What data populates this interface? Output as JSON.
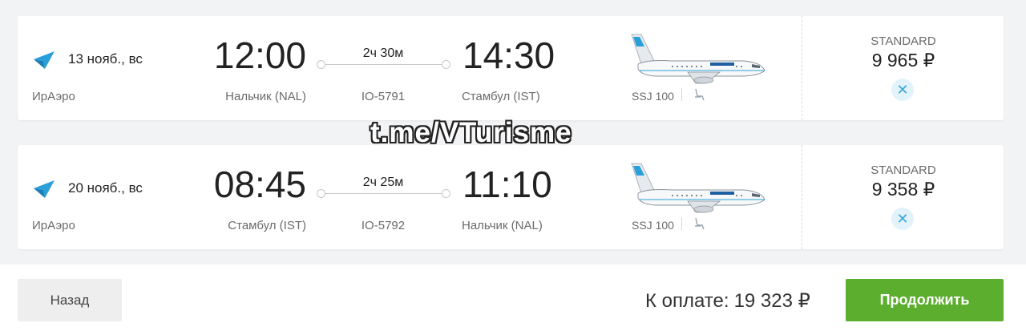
{
  "flights": [
    {
      "date": "13 нояб., вс",
      "airline": "ИрАэро",
      "dep_time": "12:00",
      "dep_airport": "Нальчик (NAL)",
      "duration": "2ч 30м",
      "flight_no": "IO-5791",
      "arr_time": "14:30",
      "arr_airport": "Стамбул (IST)",
      "aircraft": "SSJ 100",
      "fare": "STANDARD",
      "price": "9 965 ₽",
      "icons": [
        "airline-logo-icon",
        "airplane-image",
        "seat-icon",
        "close-icon"
      ]
    },
    {
      "date": "20 нояб., вс",
      "airline": "ИрАэро",
      "dep_time": "08:45",
      "dep_airport": "Стамбул (IST)",
      "duration": "2ч 25м",
      "flight_no": "IO-5792",
      "arr_time": "11:10",
      "arr_airport": "Нальчик (NAL)",
      "aircraft": "SSJ 100",
      "fare": "STANDARD",
      "price": "9 358 ₽",
      "icons": [
        "airline-logo-icon",
        "airplane-image",
        "seat-icon",
        "close-icon"
      ]
    }
  ],
  "watermark": "t.me/VTurisme",
  "footer": {
    "back_label": "Назад",
    "total_label": "К оплате:",
    "total_amount": "19 323 ₽",
    "continue_label": "Продолжить"
  },
  "colors": {
    "accent_green": "#5cae2e",
    "logo_blue": "#2b9fd9",
    "remove_bg": "#e3f3fb"
  }
}
